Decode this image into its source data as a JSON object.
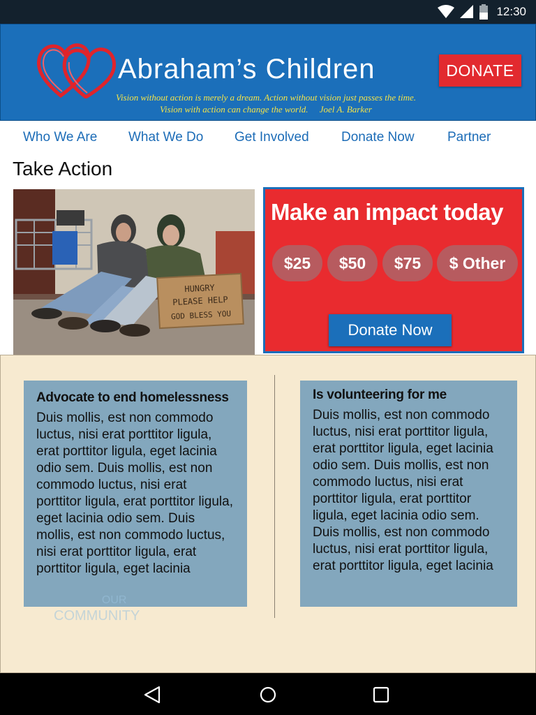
{
  "status_bar": {
    "time": "12:30"
  },
  "header": {
    "brand": "Abraham’s Children",
    "quote_line1": "Vision without action is merely a dream. Action without vision just passes the time.",
    "quote_line2": "Vision with action can change the world.     Joel A. Barker",
    "donate_label": "DONATE"
  },
  "nav": {
    "items": [
      {
        "label": "Who We Are"
      },
      {
        "label": "What We Do"
      },
      {
        "label": "Get Involved"
      },
      {
        "label": "Donate Now"
      },
      {
        "label": "Partner"
      }
    ]
  },
  "page_title": "Take Action",
  "photo": {
    "sign_text": "HUNGRY PLEASE HELP GOD BLESS YOU"
  },
  "impact": {
    "title": "Make an impact today",
    "amounts": [
      "$25",
      "$50",
      "$75",
      "$ Other"
    ],
    "donate_label": "Donate Now"
  },
  "cards": [
    {
      "title": "Advocate to end homelessness",
      "body": "Duis mollis, est non commodo luctus, nisi erat porttitor ligula, erat porttitor ligula, eget lacinia odio sem. Duis mollis, est non commodo luctus, nisi erat porttitor ligula, erat porttitor ligula, eget lacinia odio sem. Duis mollis, est non commodo luctus, nisi erat porttitor ligula, erat porttitor ligula, eget lacinia"
    },
    {
      "title": "Is volunteering for me",
      "body": "Duis mollis, est non commodo luctus, nisi erat porttitor ligula, erat porttitor ligula, eget lacinia odio sem. Duis mollis, est non commodo luctus, nisi erat porttitor ligula, erat porttitor ligula, eget lacinia odio sem. Duis mollis, est non commodo luctus, nisi erat porttitor ligula, erat porttitor ligula, eget lacinia"
    }
  ],
  "ghost_text": {
    "line1": "OUR",
    "line2": "COMMUNITY"
  },
  "colors": {
    "header_blue": "#1b6fba",
    "donate_red": "#e22a2f",
    "impact_red": "#e92b2f",
    "quote_yellow": "#f1e24a",
    "card_blue": "#83a7bd",
    "section_cream": "#f7ead0"
  },
  "icons": {
    "status": [
      "wifi-icon",
      "signal-icon",
      "battery-icon"
    ],
    "nav_bar": [
      "back-icon",
      "home-icon",
      "recents-icon"
    ],
    "logo": "hearts-logo-icon"
  }
}
